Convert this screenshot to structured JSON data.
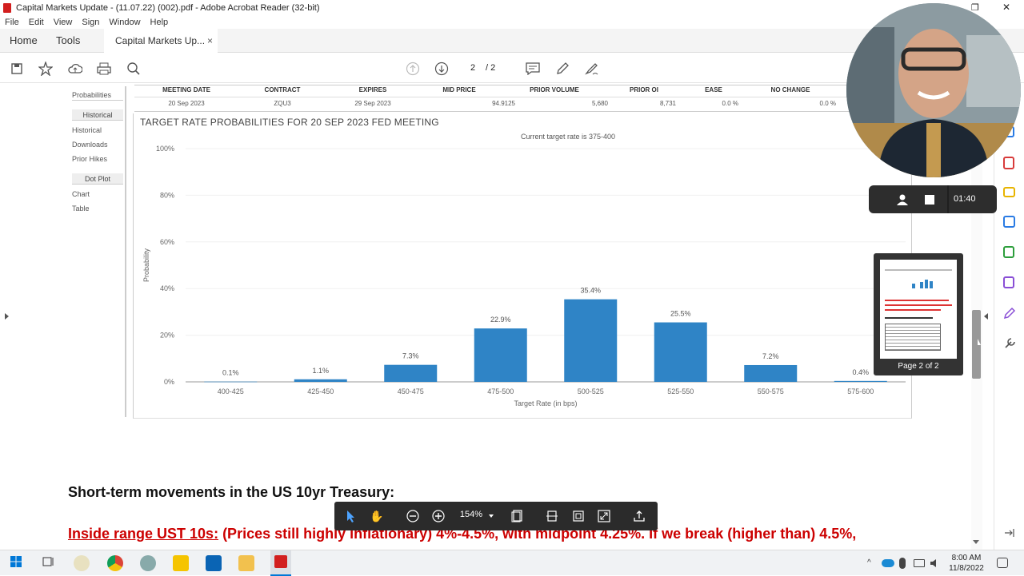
{
  "window": {
    "title": "Capital Markets Update - (11.07.22) (002).pdf - Adobe Acrobat Reader (32-bit)"
  },
  "menu": [
    "File",
    "Edit",
    "View",
    "Sign",
    "Window",
    "Help"
  ],
  "tabs": {
    "home": "Home",
    "tools": "Tools",
    "doc": "Capital Markets Up...",
    "close": "×"
  },
  "toolbar": {
    "page_current": "2",
    "page_total": "/ 2"
  },
  "sidebar": {
    "probabilities": "Probabilities",
    "historical_head": "Historical",
    "historical": "Historical",
    "downloads": "Downloads",
    "prior_hikes": "Prior Hikes",
    "dot_plot_head": "Dot Plot",
    "chart": "Chart",
    "table": "Table"
  },
  "meeting_table": {
    "headers": [
      "MEETING DATE",
      "CONTRACT",
      "EXPIRES",
      "MID PRICE",
      "PRIOR VOLUME",
      "PRIOR OI",
      "EASE",
      "NO CHANGE"
    ],
    "values": [
      "20 Sep 2023",
      "ZQU3",
      "29 Sep 2023",
      "94.9125",
      "5,680",
      "8,731",
      "0.0 %",
      "0.0 %"
    ]
  },
  "chart_title": "TARGET RATE PROBABILITIES FOR 20 SEP 2023 FED MEETING",
  "chart_data": {
    "type": "bar",
    "subtitle": "Current target rate is 375-400",
    "categories": [
      "400-425",
      "425-450",
      "450-475",
      "475-500",
      "500-525",
      "525-550",
      "550-575",
      "575-600"
    ],
    "values": [
      0.1,
      1.1,
      7.3,
      22.9,
      35.4,
      25.5,
      7.2,
      0.4
    ],
    "labels": [
      "0.1%",
      "1.1%",
      "7.3%",
      "22.9%",
      "35.4%",
      "25.5%",
      "7.2%",
      "0.4%"
    ],
    "ylabel": "Probability",
    "xlabel": "Target Rate (in bps)",
    "yticks": [
      "0%",
      "20%",
      "40%",
      "60%",
      "80%",
      "100%"
    ],
    "ylim": [
      0,
      100
    ],
    "color": "#2f84c6"
  },
  "body": {
    "heading": "Short-term movements in the US 10yr Treasury:",
    "red_label": "Inside range UST 10s:",
    "red_text": " (Prices still highly inflationary) 4%-4.5%, with midpoint 4.25%.  If we break (higher than) 4.5%,"
  },
  "float_toolbar": {
    "zoom": "154%"
  },
  "recorder": {
    "time": "01:40"
  },
  "thumbnail": {
    "label": "Page 2 of 2"
  },
  "taskbar": {
    "time": "8:00 AM",
    "date": "11/8/2022"
  }
}
